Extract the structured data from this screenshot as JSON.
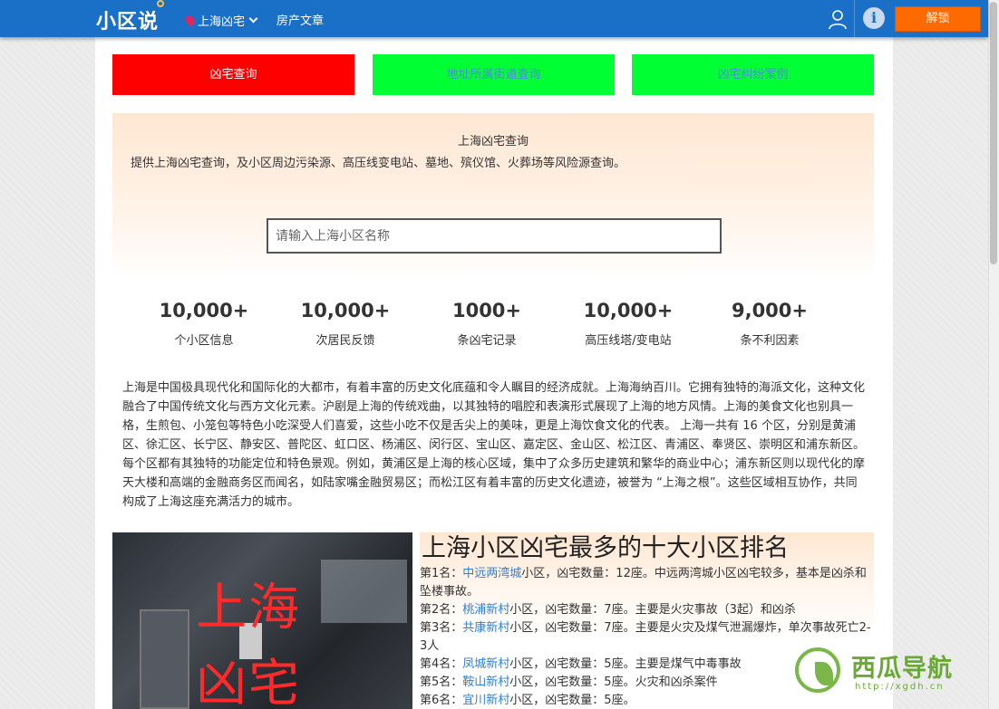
{
  "header": {
    "logo": "小区说",
    "city": "上海凶宅",
    "article_link": "房产文章",
    "unlock_label": "解锁",
    "bg_color": "#1a6fc7"
  },
  "tabs": [
    {
      "label": "凶宅查询",
      "color": "#ff0000"
    },
    {
      "label": "地址所属街道查询",
      "color": "#00ff33"
    },
    {
      "label": "凶宅纠纷案例",
      "color": "#00ff33"
    }
  ],
  "hero": {
    "title": "上海凶宅查询",
    "description": "提供上海凶宅查询，及小区周边污染源、高压线变电站、墓地、殡仪馆、火葬场等风险源查询。",
    "search_placeholder": "请输入上海小区名称"
  },
  "stats": [
    {
      "num": "10,000+",
      "label": "个小区信息"
    },
    {
      "num": "10,000+",
      "label": "次居民反馈"
    },
    {
      "num": "1000+",
      "label": "条凶宅记录"
    },
    {
      "num": "10,000+",
      "label": "高压线塔/变电站"
    },
    {
      "num": "9,000+",
      "label": "条不利因素"
    }
  ],
  "intro": "上海是中国极具现代化和国际化的大都市，有着丰富的历史文化底蕴和令人瞩目的经济成就。上海海纳百川。它拥有独特的海派文化，这种文化融合了中国传统文化与西方文化元素。沪剧是上海的传统戏曲，以其独特的唱腔和表演形式展现了上海的地方风情。上海的美食文化也别具一格，生煎包、小笼包等特色小吃深受人们喜爱，这些小吃不仅是舌尖上的美味，更是上海饮食文化的代表。 上海一共有 16 个区，分别是黄浦区、徐汇区、长宁区、静安区、普陀区、虹口区、杨浦区、闵行区、宝山区、嘉定区、金山区、松江区、青浦区、奉贤区、崇明区和浦东新区。每个区都有其独特的功能定位和特色景观。例如，黄浦区是上海的核心区域，集中了众多历史建筑和繁华的商业中心；浦东新区则以现代化的摩天大楼和高端的金融商务区而闻名，如陆家嘴金融贸易区；而松江区有着丰富的历史文化遗迹，被誉为 “上海之根”。这些区域相互协作，共同构成了上海这座充满活力的城市。",
  "photo": {
    "line1": "上海",
    "line2": "凶宅"
  },
  "ranking": {
    "title": "上海小区凶宅最多的十大小区排名",
    "items": [
      {
        "prefix": "第1名：",
        "name": "中远两湾城",
        "suffix": "小区，凶宅数量：12座。中远两湾城小区凶宅较多，基本是凶杀和坠楼事故。"
      },
      {
        "prefix": "第2名：",
        "name": "桃浦新村",
        "suffix": "小区，凶宅数量：7座。主要是火灾事故（3起）和凶杀"
      },
      {
        "prefix": "第3名：",
        "name": "共康新村",
        "suffix": "小区，凶宅数量：7座。主要是火灾及煤气泄漏爆炸，单次事故死亡2-3人"
      },
      {
        "prefix": "第4名：",
        "name": "凤城新村",
        "suffix": "小区，凶宅数量：5座。主要是煤气中毒事故"
      },
      {
        "prefix": "第5名：",
        "name": "鞍山新村",
        "suffix": "小区，凶宅数量：5座。火灾和凶杀案件"
      },
      {
        "prefix": "第6名：",
        "name": "宜川新村",
        "suffix": "小区，凶宅数量：5座。"
      }
    ]
  },
  "watermark": {
    "brand": "西瓜导航",
    "url": "http://xgdh.cn"
  }
}
